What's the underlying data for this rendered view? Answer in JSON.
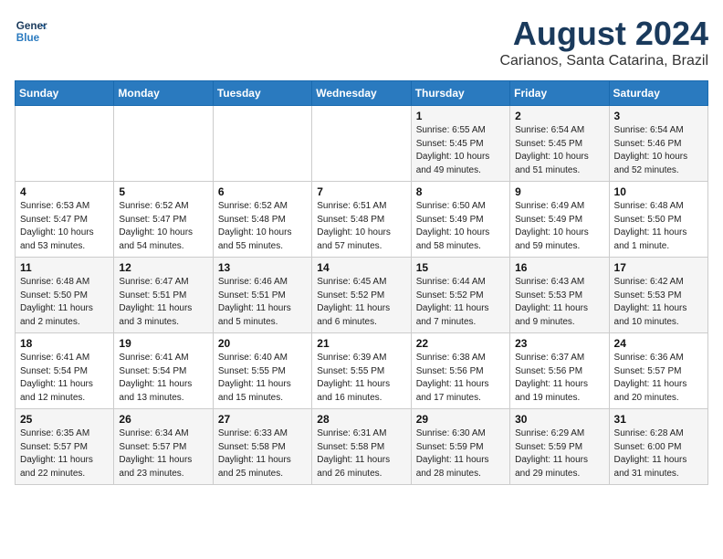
{
  "header": {
    "logo_line1": "General",
    "logo_line2": "Blue",
    "month_year": "August 2024",
    "location": "Carianos, Santa Catarina, Brazil"
  },
  "weekdays": [
    "Sunday",
    "Monday",
    "Tuesday",
    "Wednesday",
    "Thursday",
    "Friday",
    "Saturday"
  ],
  "weeks": [
    [
      {
        "num": "",
        "detail": ""
      },
      {
        "num": "",
        "detail": ""
      },
      {
        "num": "",
        "detail": ""
      },
      {
        "num": "",
        "detail": ""
      },
      {
        "num": "1",
        "detail": "Sunrise: 6:55 AM\nSunset: 5:45 PM\nDaylight: 10 hours\nand 49 minutes."
      },
      {
        "num": "2",
        "detail": "Sunrise: 6:54 AM\nSunset: 5:45 PM\nDaylight: 10 hours\nand 51 minutes."
      },
      {
        "num": "3",
        "detail": "Sunrise: 6:54 AM\nSunset: 5:46 PM\nDaylight: 10 hours\nand 52 minutes."
      }
    ],
    [
      {
        "num": "4",
        "detail": "Sunrise: 6:53 AM\nSunset: 5:47 PM\nDaylight: 10 hours\nand 53 minutes."
      },
      {
        "num": "5",
        "detail": "Sunrise: 6:52 AM\nSunset: 5:47 PM\nDaylight: 10 hours\nand 54 minutes."
      },
      {
        "num": "6",
        "detail": "Sunrise: 6:52 AM\nSunset: 5:48 PM\nDaylight: 10 hours\nand 55 minutes."
      },
      {
        "num": "7",
        "detail": "Sunrise: 6:51 AM\nSunset: 5:48 PM\nDaylight: 10 hours\nand 57 minutes."
      },
      {
        "num": "8",
        "detail": "Sunrise: 6:50 AM\nSunset: 5:49 PM\nDaylight: 10 hours\nand 58 minutes."
      },
      {
        "num": "9",
        "detail": "Sunrise: 6:49 AM\nSunset: 5:49 PM\nDaylight: 10 hours\nand 59 minutes."
      },
      {
        "num": "10",
        "detail": "Sunrise: 6:48 AM\nSunset: 5:50 PM\nDaylight: 11 hours\nand 1 minute."
      }
    ],
    [
      {
        "num": "11",
        "detail": "Sunrise: 6:48 AM\nSunset: 5:50 PM\nDaylight: 11 hours\nand 2 minutes."
      },
      {
        "num": "12",
        "detail": "Sunrise: 6:47 AM\nSunset: 5:51 PM\nDaylight: 11 hours\nand 3 minutes."
      },
      {
        "num": "13",
        "detail": "Sunrise: 6:46 AM\nSunset: 5:51 PM\nDaylight: 11 hours\nand 5 minutes."
      },
      {
        "num": "14",
        "detail": "Sunrise: 6:45 AM\nSunset: 5:52 PM\nDaylight: 11 hours\nand 6 minutes."
      },
      {
        "num": "15",
        "detail": "Sunrise: 6:44 AM\nSunset: 5:52 PM\nDaylight: 11 hours\nand 7 minutes."
      },
      {
        "num": "16",
        "detail": "Sunrise: 6:43 AM\nSunset: 5:53 PM\nDaylight: 11 hours\nand 9 minutes."
      },
      {
        "num": "17",
        "detail": "Sunrise: 6:42 AM\nSunset: 5:53 PM\nDaylight: 11 hours\nand 10 minutes."
      }
    ],
    [
      {
        "num": "18",
        "detail": "Sunrise: 6:41 AM\nSunset: 5:54 PM\nDaylight: 11 hours\nand 12 minutes."
      },
      {
        "num": "19",
        "detail": "Sunrise: 6:41 AM\nSunset: 5:54 PM\nDaylight: 11 hours\nand 13 minutes."
      },
      {
        "num": "20",
        "detail": "Sunrise: 6:40 AM\nSunset: 5:55 PM\nDaylight: 11 hours\nand 15 minutes."
      },
      {
        "num": "21",
        "detail": "Sunrise: 6:39 AM\nSunset: 5:55 PM\nDaylight: 11 hours\nand 16 minutes."
      },
      {
        "num": "22",
        "detail": "Sunrise: 6:38 AM\nSunset: 5:56 PM\nDaylight: 11 hours\nand 17 minutes."
      },
      {
        "num": "23",
        "detail": "Sunrise: 6:37 AM\nSunset: 5:56 PM\nDaylight: 11 hours\nand 19 minutes."
      },
      {
        "num": "24",
        "detail": "Sunrise: 6:36 AM\nSunset: 5:57 PM\nDaylight: 11 hours\nand 20 minutes."
      }
    ],
    [
      {
        "num": "25",
        "detail": "Sunrise: 6:35 AM\nSunset: 5:57 PM\nDaylight: 11 hours\nand 22 minutes."
      },
      {
        "num": "26",
        "detail": "Sunrise: 6:34 AM\nSunset: 5:57 PM\nDaylight: 11 hours\nand 23 minutes."
      },
      {
        "num": "27",
        "detail": "Sunrise: 6:33 AM\nSunset: 5:58 PM\nDaylight: 11 hours\nand 25 minutes."
      },
      {
        "num": "28",
        "detail": "Sunrise: 6:31 AM\nSunset: 5:58 PM\nDaylight: 11 hours\nand 26 minutes."
      },
      {
        "num": "29",
        "detail": "Sunrise: 6:30 AM\nSunset: 5:59 PM\nDaylight: 11 hours\nand 28 minutes."
      },
      {
        "num": "30",
        "detail": "Sunrise: 6:29 AM\nSunset: 5:59 PM\nDaylight: 11 hours\nand 29 minutes."
      },
      {
        "num": "31",
        "detail": "Sunrise: 6:28 AM\nSunset: 6:00 PM\nDaylight: 11 hours\nand 31 minutes."
      }
    ]
  ]
}
